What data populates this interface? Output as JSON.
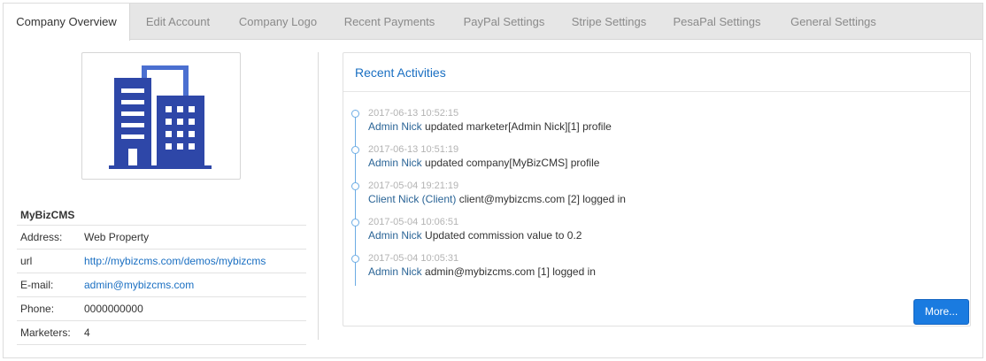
{
  "tabs": [
    {
      "label": "Company Overview",
      "active": true
    },
    {
      "label": "Edit Account",
      "active": false
    },
    {
      "label": "Company Logo",
      "active": false
    },
    {
      "label": "Recent Payments",
      "active": false
    },
    {
      "label": "PayPal Settings",
      "active": false
    },
    {
      "label": "Stripe Settings",
      "active": false
    },
    {
      "label": "PesaPal Settings",
      "active": false
    },
    {
      "label": "General Settings",
      "active": false
    }
  ],
  "company": {
    "logo_icon": "office-building-icon",
    "name": "MyBizCMS",
    "fields": [
      {
        "label": "Address:",
        "value": "Web Property"
      },
      {
        "label": "url",
        "value": "http://mybizcms.com/demos/mybizcms"
      },
      {
        "label": "E-mail:",
        "value": "admin@mybizcms.com"
      },
      {
        "label": "Phone:",
        "value": "0000000000"
      },
      {
        "label": "Marketers:",
        "value": "4"
      }
    ]
  },
  "activities": {
    "title": "Recent Activities",
    "items": [
      {
        "time": "2017-06-13 10:52:15",
        "actor": "Admin Nick",
        "text": " updated marketer[Admin Nick][1] profile"
      },
      {
        "time": "2017-06-13 10:51:19",
        "actor": "Admin Nick",
        "text": " updated company[MyBizCMS] profile"
      },
      {
        "time": "2017-05-04 19:21:19",
        "actor": "Client Nick (Client)",
        "text": " client@mybizcms.com [2] logged in"
      },
      {
        "time": "2017-05-04 10:06:51",
        "actor": "Admin Nick",
        "text": " Updated commission value to 0.2"
      },
      {
        "time": "2017-05-04 10:05:31",
        "actor": "Admin Nick",
        "text": " admin@mybizcms.com [1] logged in"
      }
    ],
    "more_label": "More..."
  },
  "colors": {
    "accent": "#1a7be0",
    "link": "#1a6fc2",
    "logo_dark": "#2e47a8",
    "logo_light": "#4b6fd0"
  }
}
